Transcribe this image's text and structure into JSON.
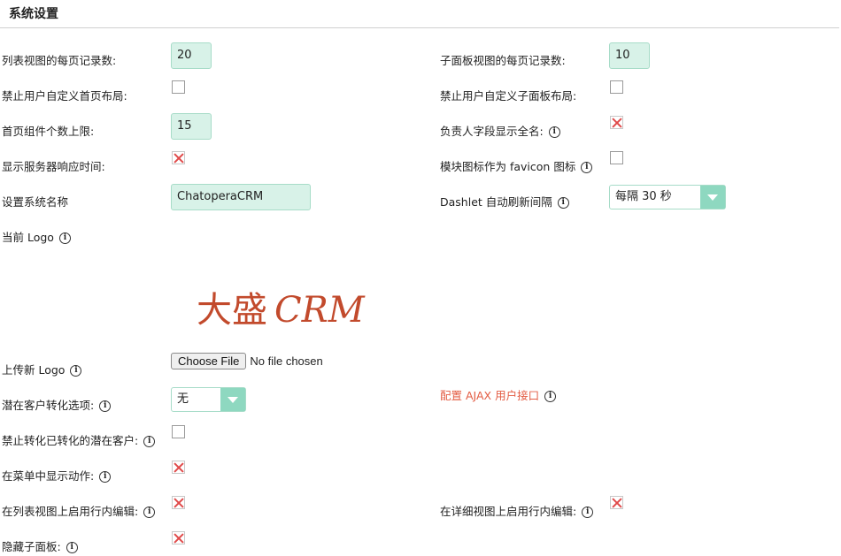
{
  "section": {
    "title": "系统设置"
  },
  "fields": {
    "list_per_page": {
      "label": "列表视图的每页记录数:",
      "value": "20"
    },
    "subpanel_per_page": {
      "label": "子面板视图的每页记录数:",
      "value": "10"
    },
    "disable_home_layout": {
      "label": "禁止用户自定义首页布局:",
      "checked": false
    },
    "disable_subpanel_layout": {
      "label": "禁止用户自定义子面板布局:",
      "checked": false
    },
    "max_dashlets": {
      "label": "首页组件个数上限:",
      "value": "15"
    },
    "assigned_full_name": {
      "label": "负责人字段显示全名:",
      "checked": true
    },
    "show_response_time": {
      "label": "显示服务器响应时间:",
      "checked": true
    },
    "module_favicon": {
      "label": "模块图标作为 favicon 图标",
      "checked": false
    },
    "system_name": {
      "label": "设置系统名称",
      "value": "ChatoperaCRM"
    },
    "dashlet_refresh": {
      "label": "Dashlet 自动刷新间隔",
      "selected": "每隔 30 秒"
    },
    "current_logo": {
      "label": "当前 Logo",
      "logo_cn": "大盛",
      "logo_en": "CRM"
    },
    "upload_logo": {
      "label": "上传新 Logo",
      "button": "Choose File",
      "status": "No file chosen"
    },
    "lead_conversion": {
      "label": "潜在客户转化选项:",
      "selected": "无"
    },
    "ajax_ui": {
      "label": "配置 AJAX 用户接口"
    },
    "prevent_converted_lead": {
      "label": "禁止转化已转化的潜在客户:",
      "checked": false
    },
    "show_actions_menu": {
      "label": "在菜单中显示动作:",
      "checked": true
    },
    "inline_edit_list": {
      "label": "在列表视图上启用行内编辑:",
      "checked": true
    },
    "inline_edit_detail": {
      "label": "在详细视图上启用行内编辑:",
      "checked": true
    },
    "hide_subpanels": {
      "label": "隐藏子面板:",
      "checked": true
    }
  },
  "icons": {
    "info": "ⅰ"
  },
  "colors": {
    "input_bg": "#d8f2e8",
    "accent": "#8ed8c0",
    "check_x": "#e04a4a",
    "link": "#e35d44",
    "logo": "#c24a2c"
  }
}
